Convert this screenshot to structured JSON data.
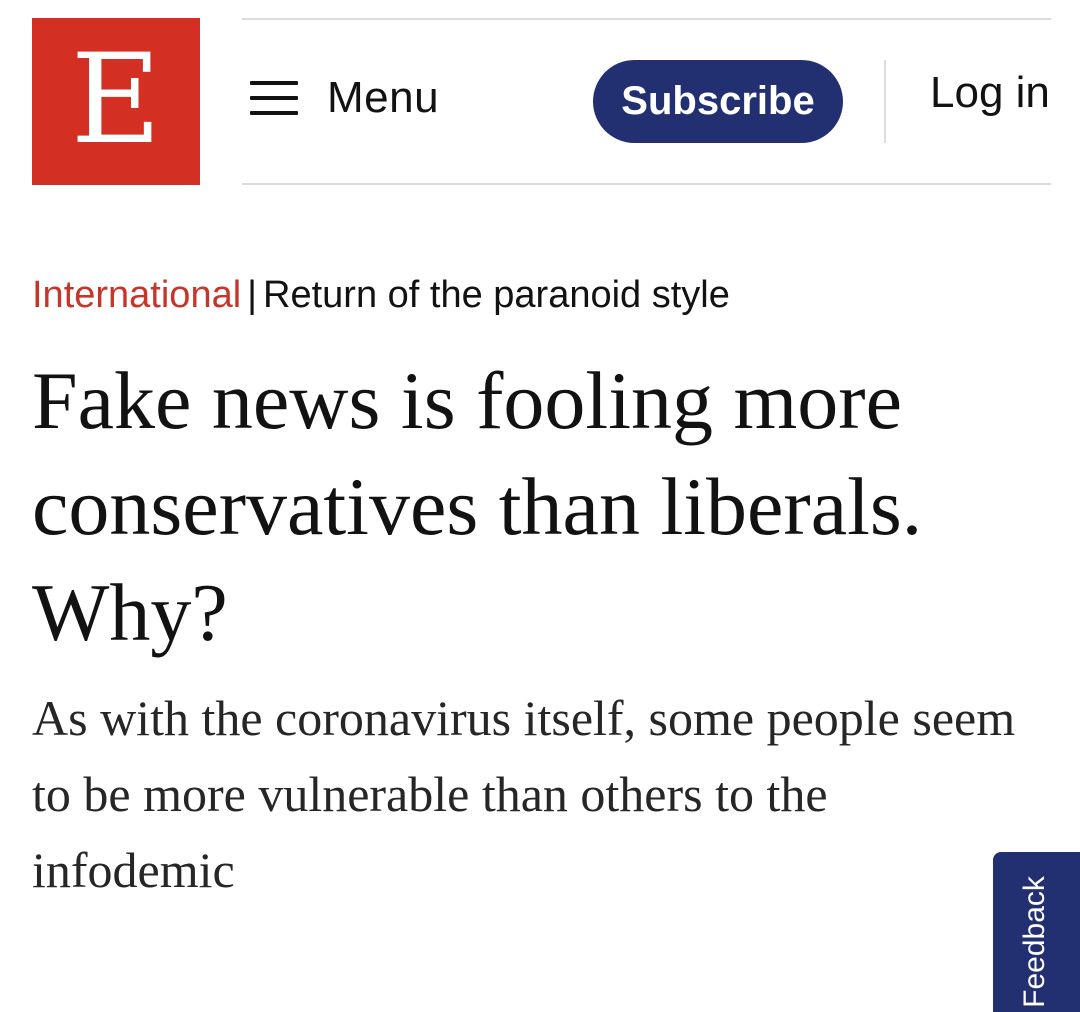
{
  "header": {
    "logo_letter": "E",
    "menu_label": "Menu",
    "subscribe_label": "Subscribe",
    "login_label": "Log in"
  },
  "article": {
    "section": "International",
    "separator": "|",
    "flytitle": "Return of the paranoid style",
    "headline": "Fake news is fooling more conservatives than liberals. Why?",
    "standfirst": "As with the coronavirus itself, some people seem to be more vulnerable than others to the infodemic"
  },
  "feedback": {
    "label": "Feedback"
  },
  "colors": {
    "brand_red": "#d32f22",
    "section_red": "#c6352a",
    "navy": "#223072",
    "text": "#121212"
  },
  "icons": {
    "menu": "hamburger-menu-icon"
  }
}
